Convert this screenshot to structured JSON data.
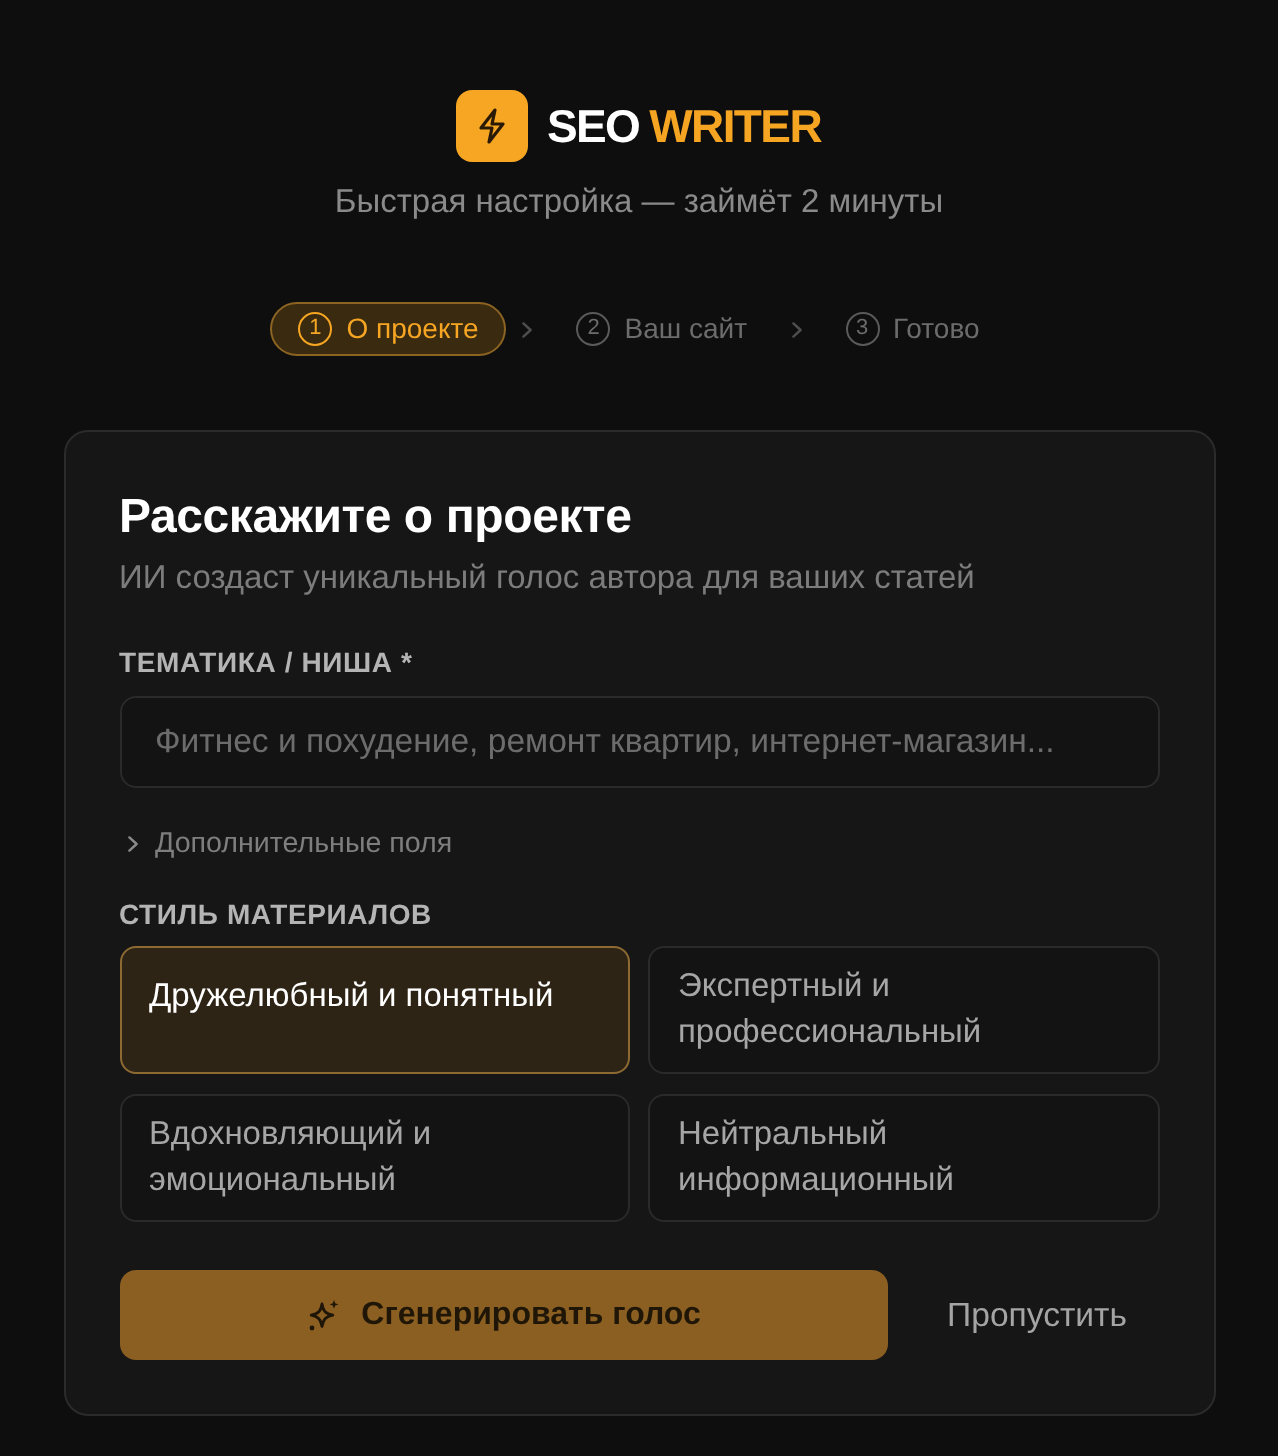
{
  "header": {
    "logo": {
      "words": [
        {
          "text": "SEO",
          "accent": false
        },
        {
          "text": "WRITER",
          "accent": true
        }
      ]
    },
    "subtitle": "Быстрая настройка — займёт 2 минуты"
  },
  "steps": [
    {
      "number": "1",
      "label": "О проекте",
      "selected": true
    },
    {
      "number": "2",
      "label": "Ваш сайт",
      "selected": false
    },
    {
      "number": "3",
      "label": "Готово",
      "selected": false
    }
  ],
  "card": {
    "title": "Расскажите о проекте",
    "subtitle": "ИИ создаст уникальный голос автора для ваших статей",
    "topic_field": {
      "label": "ТЕМАТИКА / НИША *",
      "placeholder": "Фитнес и похудение, ремонт квартир, интернет-магазин..."
    },
    "extra_fields": {
      "label": "Дополнительные поля",
      "expanded": false
    },
    "style_section": {
      "label": "СТИЛЬ МАТЕРИАЛОВ",
      "options": [
        {
          "label": "Дружелюбный и понятный",
          "selected": true
        },
        {
          "label": "Экспертный и профессиональный",
          "selected": false
        },
        {
          "label": "Вдохновляющий и эмоциональный",
          "selected": false
        },
        {
          "label": "Нейтральный информационный",
          "selected": false
        }
      ]
    },
    "actions": {
      "primary": "Сгенерировать голос",
      "secondary": "Пропустить"
    }
  }
}
